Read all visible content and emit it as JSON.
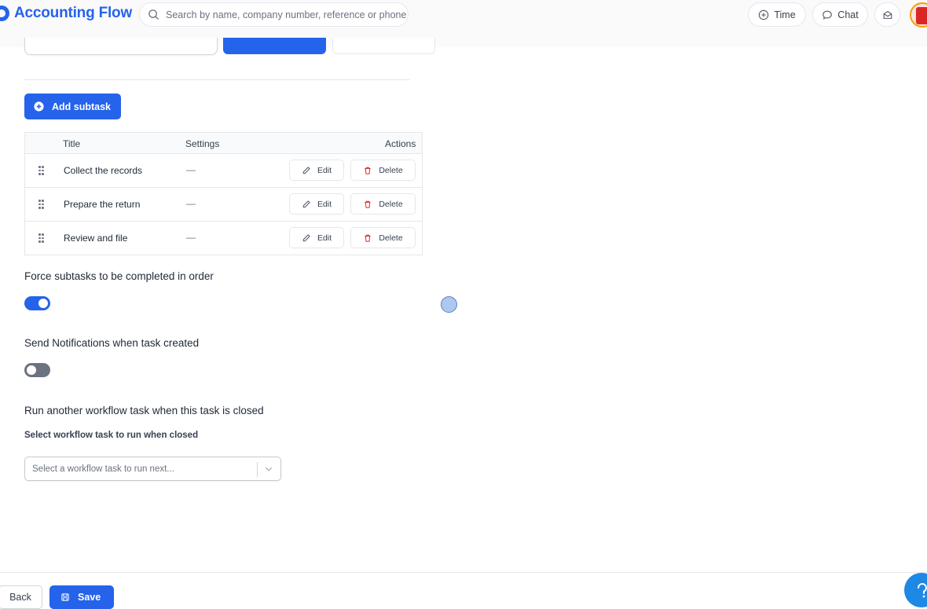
{
  "app": {
    "name": "Accounting Flow"
  },
  "header": {
    "search_placeholder": "Search by name, company number, reference or phone",
    "time_label": "Time",
    "chat_label": "Chat"
  },
  "subtasks": {
    "add_label": "Add subtask",
    "columns": {
      "title": "Title",
      "settings": "Settings",
      "actions": "Actions"
    },
    "rows": [
      {
        "title": "Collect the records",
        "settings": "—"
      },
      {
        "title": "Prepare the return",
        "settings": "—"
      },
      {
        "title": "Review and file",
        "settings": "—"
      }
    ],
    "edit_label": "Edit",
    "delete_label": "Delete"
  },
  "options": {
    "force_order_label": "Force subtasks to be completed in order",
    "force_order_on": true,
    "notify_label": "Send Notifications when task created",
    "notify_on": false,
    "run_another_label": "Run another workflow task when this task is closed",
    "select_label": "Select workflow task to run when closed",
    "select_placeholder": "Select a workflow task to run next..."
  },
  "footer": {
    "back_label": "Back",
    "save_label": "Save"
  },
  "colors": {
    "accent": "#2563eb",
    "toggle_off": "#6b7280",
    "danger": "#dc2626"
  }
}
